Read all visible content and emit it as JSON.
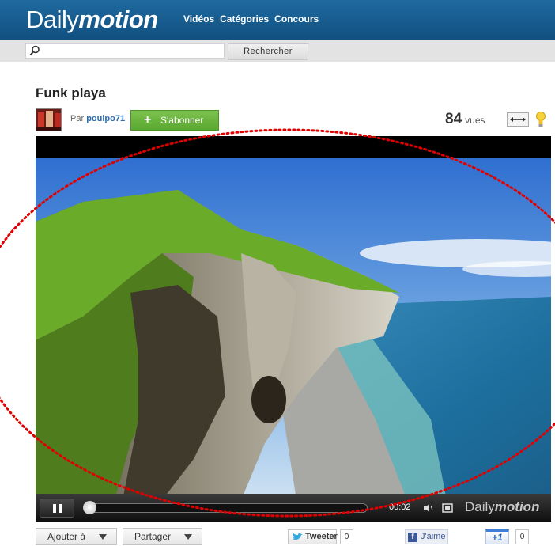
{
  "header": {
    "logo_regular": "Daily",
    "logo_bold": "motion",
    "nav": [
      "Vidéos",
      "Catégories",
      "Concours"
    ]
  },
  "search": {
    "placeholder": "",
    "button_label": "Rechercher"
  },
  "video": {
    "title": "Funk playa",
    "by_prefix": "Par",
    "uploader": "poulpo71",
    "subscribe_label": "S'abonner",
    "views_count": "84",
    "views_unit": "vues",
    "player": {
      "timecode": "00:02",
      "watermark_regular": "Daily",
      "watermark_bold": "motion",
      "progress_fraction": 0.02
    }
  },
  "actions": {
    "add_to": "Ajouter à",
    "share": "Partager",
    "tweet": "Tweeter",
    "tweet_count": "0",
    "like": "J'aime",
    "plus_one": "+1",
    "plus_count": "0"
  },
  "colors": {
    "header_blue": "#1a5f93",
    "subscribe_green": "#6cb53f",
    "annotation_red": "#e00000"
  }
}
